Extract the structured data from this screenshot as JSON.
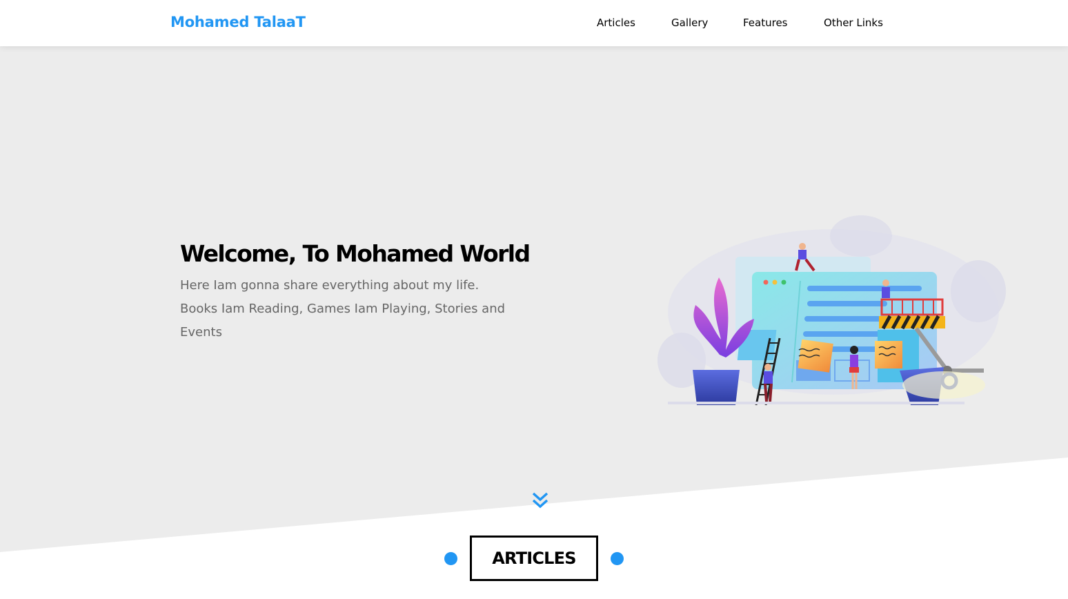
{
  "header": {
    "logo": "Mohamed TalaaT",
    "nav": [
      "Articles",
      "Gallery",
      "Features",
      "Other Links"
    ]
  },
  "landing": {
    "title": "Welcome, To Mohamed World",
    "text": "Here Iam gonna share everything about my life. Books Iam Reading, Games Iam Playing, Stories and Events"
  },
  "icons": {
    "go_down": "double-chevron-down-icon"
  },
  "articles_section": {
    "title": "ARTICLES"
  },
  "colors": {
    "accent": "#2196f3",
    "landing_bg": "#ececec",
    "text_muted": "#666666"
  }
}
